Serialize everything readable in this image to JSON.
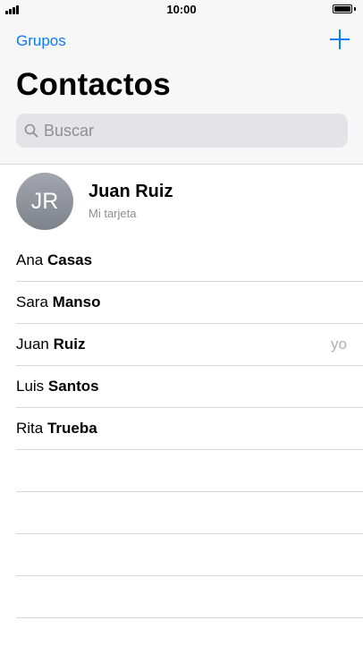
{
  "status_bar": {
    "time": "10:00"
  },
  "nav": {
    "left_label": "Grupos",
    "title": "Contactos"
  },
  "search": {
    "placeholder": "Buscar"
  },
  "my_card": {
    "initials": "JR",
    "name": "Juan Ruiz",
    "subtitle": "Mi tarjeta"
  },
  "contacts": [
    {
      "first": "Ana",
      "last": "Casas",
      "tag": ""
    },
    {
      "first": "Sara",
      "last": "Manso",
      "tag": ""
    },
    {
      "first": "Juan",
      "last": "Ruiz",
      "tag": "yo"
    },
    {
      "first": "Luis",
      "last": "Santos",
      "tag": ""
    },
    {
      "first": "Rita",
      "last": "Trueba",
      "tag": ""
    }
  ]
}
